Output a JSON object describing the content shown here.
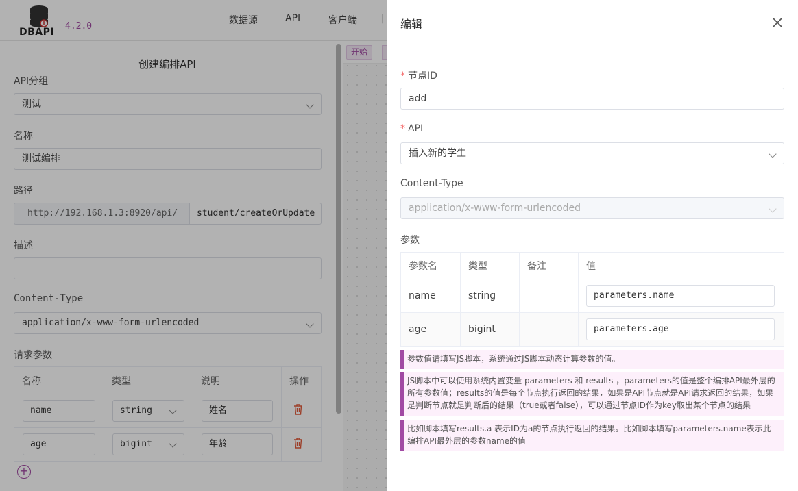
{
  "header": {
    "logo_text": "DBAPI",
    "version": "4.2.0",
    "nav": [
      "数据源",
      "API",
      "客户端",
      "..."
    ]
  },
  "form": {
    "title": "创建编排API",
    "group_label": "API分组",
    "group_value": "测试",
    "name_label": "名称",
    "name_value": "测试编排",
    "path_label": "路径",
    "path_prefix": "http://192.168.1.3:8920/api/",
    "path_value": "student/createOrUpdate",
    "desc_label": "描述",
    "desc_value": "",
    "ctype_label": "Content-Type",
    "ctype_value": "application/x-www-form-urlencoded",
    "params_label": "请求参数",
    "params_headers": [
      "名称",
      "类型",
      "说明",
      "操作"
    ],
    "params": [
      {
        "name": "name",
        "type": "string",
        "desc": "姓名"
      },
      {
        "name": "age",
        "type": "bigint",
        "desc": "年龄"
      }
    ]
  },
  "canvas": {
    "start_label": "开始"
  },
  "drawer": {
    "title": "编辑",
    "node_id_label": "节点ID",
    "node_id_value": "add",
    "api_label": "API",
    "api_value": "插入新的学生",
    "ctype_label": "Content-Type",
    "ctype_value": "application/x-www-form-urlencoded",
    "params_label": "参数",
    "table_headers": [
      "参数名",
      "类型",
      "备注",
      "值"
    ],
    "rows": [
      {
        "name": "name",
        "type": "string",
        "note": "",
        "value": "parameters.name"
      },
      {
        "name": "age",
        "type": "bigint",
        "note": "",
        "value": "parameters.age"
      }
    ],
    "tips": [
      "参数值请填写JS脚本，系统通过JS脚本动态计算参数的值。",
      "JS脚本中可以使用系统内置变量 parameters 和 results ，parameters的值是整个编排API最外层的所有参数值；results的值是每个节点执行返回的结果，如果是API节点就是API请求返回的结果，如果是判断节点就是判断后的结果（true或者false），可以通过节点ID作为key取出某个节点的结果",
      "比如脚本填写results.a 表示ID为a的节点执行返回的结果。比如脚本填写parameters.name表示此编排API最外层的参数name的值"
    ]
  },
  "colors": {
    "brand": "#a14aa3",
    "required": "#f56c6c",
    "delete": "#e05a3a"
  }
}
